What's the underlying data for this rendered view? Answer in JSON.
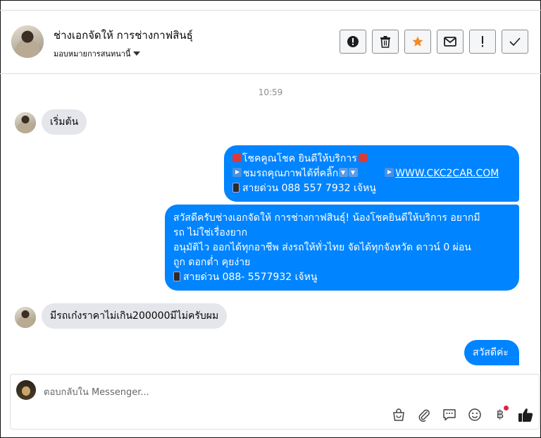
{
  "header": {
    "name": "ช่างเอกจัดให้ การช่างกาฟสินธุ์",
    "assignee": "มอบหมายการสนทนานี้",
    "tools": [
      {
        "icon": "alert-circle-icon",
        "label": "Mark as spam"
      },
      {
        "icon": "trash-icon",
        "label": "Delete"
      },
      {
        "icon": "star-icon",
        "label": "Star",
        "color": "#f38b2a"
      },
      {
        "icon": "envelope-icon",
        "label": "Mark unread"
      },
      {
        "icon": "exclamation-icon",
        "label": "Follow up"
      },
      {
        "icon": "check-icon",
        "label": "Done"
      }
    ]
  },
  "thread": {
    "timestamp": "10:59",
    "incoming_1": "เริ่มต้น",
    "outgoing_1": {
      "line1": "โชคคูณโชค ยินดีให้บริการ",
      "line2_a": "ชมรถคุณภาพได้ที่คลิ๊ก",
      "line2_link": "WWW.CKC2CAR.COM",
      "line3": "สายด่วน 088 557 7932 เจ้หนู"
    },
    "outgoing_2": {
      "line1": "สวัสดีครับช่างเอกจัดให้ การช่างกาฟสินธุ์! น้องโชคยินดีให้บริการ อยากมี",
      "line2": "รถ ไม่ใช่เรื่องยาก",
      "line3": "อนุมัติไว ออกได้ทุกอาชีพ ส่งรถให้ทั่วไทย จัดได้ทุกจังหวัด ดาวน์ 0  ผ่อน",
      "line4": "ถูก ดอกต่ำ คุยง่าย",
      "line5": "สายด่วน 088- 5577932 เจ้หนู"
    },
    "incoming_2": "มีรถเก๋งราคาไม่เกิน200000มีไม่ครับผม",
    "outgoing_3": "สวัสดีค่ะ"
  },
  "composer": {
    "placeholder": "ตอบกลับใน Messenger...",
    "icons": [
      "bag-icon",
      "paperclip-icon",
      "chat-icon",
      "emoji-icon",
      "baht-icon",
      "thumbs-up-icon"
    ],
    "baht_symbol": "฿",
    "accent": "#0084ff"
  }
}
